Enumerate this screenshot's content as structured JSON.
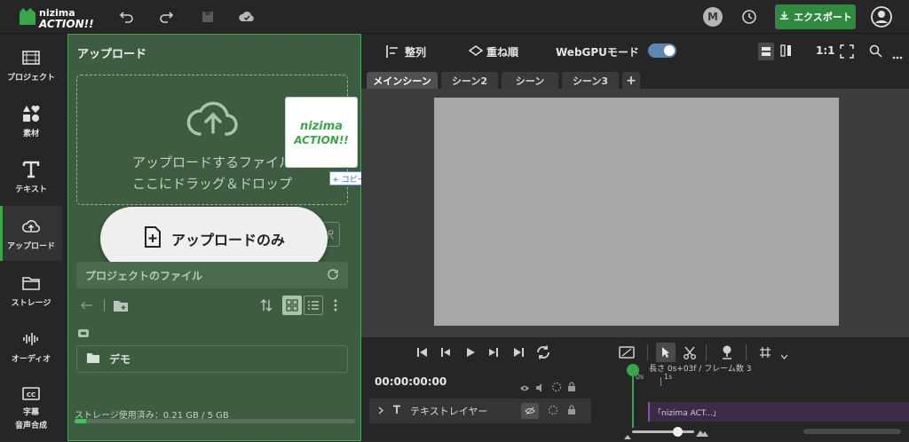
{
  "app": {
    "logo_top": "nizima",
    "logo_bottom": "ACTION!!"
  },
  "topbar": {
    "undo_icon": "undo-icon",
    "redo_icon": "redo-icon",
    "save_icon": "save-icon",
    "cloud_icon": "cloud-save-icon",
    "avatar_letter": "M",
    "export_label": "エクスポート",
    "accent_color": "#2e8a3e"
  },
  "sidebar": {
    "items": [
      {
        "label": "プロジェクト",
        "icon": "film-icon"
      },
      {
        "label": "素材",
        "icon": "shapes-icon"
      },
      {
        "label": "テキスト",
        "icon": "text-icon"
      },
      {
        "label": "アップロード",
        "icon": "cloud-upload-icon"
      },
      {
        "label": "ストレージ",
        "icon": "folder-icon"
      },
      {
        "label": "オーディオ",
        "icon": "audio-wave-icon"
      },
      {
        "label": "字幕",
        "label2": "音声合成",
        "icon": "cc-icon"
      }
    ],
    "active": "アップロード"
  },
  "upload_panel": {
    "title": "アップロード",
    "drop_line1": "アップロードするファイル",
    "drop_line2": "ここにドラッグ＆ドロップ",
    "select_button_fragment": "択",
    "copy_badge": "+ コピー",
    "thumbnail_logo_top": "nizima",
    "thumbnail_logo_bottom": "ACTION!!",
    "pill_label": "アップロードのみ",
    "project_files_label": "プロジェクトのファイル",
    "folder_name": "デモ",
    "storage_text": "ストレージ使用済み：0.21 GB / 5 GB",
    "storage_used_fraction": 0.042
  },
  "toolbar": {
    "align_label": "整列",
    "order_label": "重ね順",
    "webgpu_label": "WebGPUモード",
    "webgpu_on": true,
    "ratio_label": "1:1"
  },
  "scenes": {
    "tabs": [
      "メインシーン",
      "シーン2",
      "シーン",
      "シーン3"
    ],
    "active": "メインシーン",
    "add_label": "+"
  },
  "player": {
    "timecode": "00:00:00:00",
    "length_text": "長さ 0s+03f / フレーム数 3",
    "ruler_0": "0s",
    "ruler_1": "1s",
    "layer_name": "テキストレイヤー",
    "clip_label": "「nizima ACT...」"
  }
}
